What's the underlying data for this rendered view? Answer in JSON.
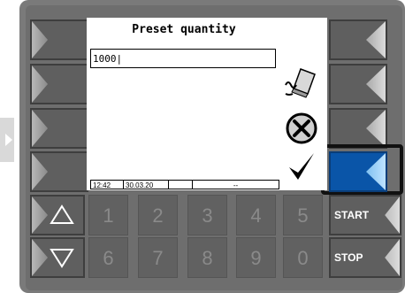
{
  "screen": {
    "title": "Preset quantity",
    "input_value": "1000|"
  },
  "icons": {
    "eraser": "eraser-icon",
    "cancel": "cancel-circle-icon",
    "confirm": "checkmark-icon"
  },
  "statusbar": {
    "time": "12:42",
    "date": "30.03.20",
    "field3": "",
    "field4": "--"
  },
  "keypad": {
    "row1": [
      "1",
      "2",
      "3",
      "4",
      "5"
    ],
    "row2": [
      "6",
      "7",
      "8",
      "9",
      "0"
    ]
  },
  "commands": {
    "start": "START",
    "stop": "STOP"
  },
  "colors": {
    "active_key": "#0a55a8",
    "key_gray": "#5f5f5f"
  }
}
